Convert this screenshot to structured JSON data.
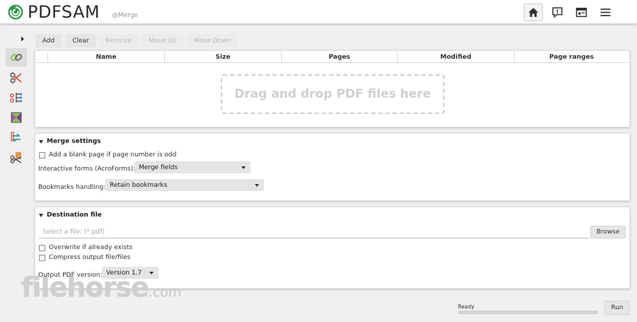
{
  "app": {
    "logo_text": "PDFSAM",
    "module_label": "@Merge"
  },
  "header": {
    "buttons": [
      {
        "icon": "home-icon",
        "active": true
      },
      {
        "icon": "news-icon",
        "active": false
      },
      {
        "icon": "dashboard-icon",
        "active": false
      },
      {
        "icon": "menu-icon",
        "active": false
      }
    ]
  },
  "sidebar": {
    "tools": [
      {
        "icon": "merge-icon",
        "active": true
      },
      {
        "icon": "split-icon",
        "active": false
      },
      {
        "icon": "split-by-bookmarks-icon",
        "active": false
      },
      {
        "icon": "alternate-mix-icon",
        "active": false
      },
      {
        "icon": "rotate-icon",
        "active": false
      },
      {
        "icon": "extract-icon",
        "active": false
      }
    ]
  },
  "toolbar": {
    "add_label": "Add",
    "clear_label": "Clear",
    "remove_label": "Remove",
    "move_up_label": "Move Up",
    "move_down_label": "Move Down"
  },
  "table": {
    "columns": [
      "Name",
      "Size",
      "Pages",
      "Modified",
      "Page ranges"
    ],
    "drop_hint": "Drag and drop PDF files here"
  },
  "merge_settings": {
    "title": "Merge settings",
    "blank_page_label": "Add a blank page if page number is odd",
    "blank_page_checked": false,
    "forms_label": "Interactive forms (AcroForms):",
    "forms_value": "Merge fields",
    "bookmarks_label": "Bookmarks handling:",
    "bookmarks_value": "Retain bookmarks"
  },
  "destination": {
    "title": "Destination file",
    "file_placeholder": "Select a file: (*.pdf)",
    "browse_label": "Browse",
    "overwrite_label": "Overwrite if already exists",
    "overwrite_checked": false,
    "compress_label": "Compress output file/files",
    "compress_checked": false,
    "version_label": "Output PDF version:",
    "version_value": "Version 1.7"
  },
  "footer": {
    "status": "Ready",
    "progress": 0,
    "run_label": "Run"
  },
  "watermark": {
    "text": "filehorse",
    "suffix": ".com"
  },
  "colors": {
    "accent_green": "#8cc63f",
    "logo_green": "#2e9a45",
    "background": "#f0f0f0"
  }
}
